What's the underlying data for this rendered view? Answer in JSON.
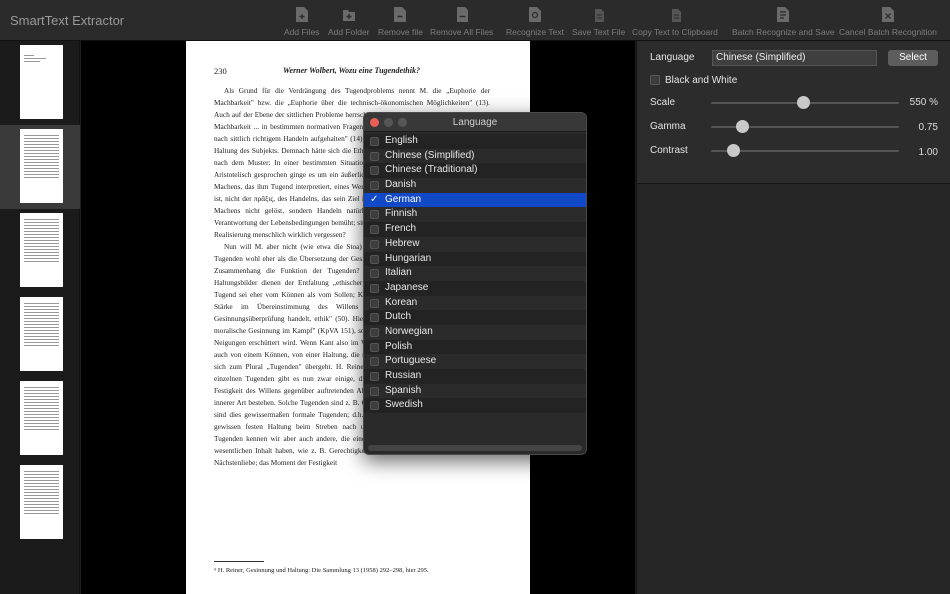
{
  "app": {
    "title": "SmartText Extractor"
  },
  "toolbar": [
    {
      "name": "add-files",
      "label": "Add Files"
    },
    {
      "name": "add-folder",
      "label": "Add Folder"
    },
    {
      "name": "remove-file",
      "label": "Remove file"
    },
    {
      "name": "remove-all-files",
      "label": "Remove All Files"
    },
    {
      "name": "recognize-text",
      "label": "Recognize Text"
    },
    {
      "name": "save-text-file",
      "label": "Save Text File"
    },
    {
      "name": "copy-text",
      "label": "Copy Text to Clipboard"
    },
    {
      "name": "batch-recognize",
      "label": "Batch Recognize and Save"
    },
    {
      "name": "cancel-batch",
      "label": "Cancel Batch Recognition"
    }
  ],
  "settings": {
    "language_label": "Language",
    "language_value": "Chinese (Simplified)",
    "select_label": "Select",
    "bw_label": "Black and White",
    "scale_label": "Scale",
    "scale_value": "550 %",
    "scale_pos": 0.49,
    "gamma_label": "Gamma",
    "gamma_value": "0.75",
    "gamma_pos": 0.17,
    "contrast_label": "Contrast",
    "contrast_value": "1.00",
    "contrast_pos": 0.12
  },
  "dialog": {
    "title": "Language",
    "items": [
      "English",
      "Chinese (Simplified)",
      "Chinese (Traditional)",
      "Danish",
      "German",
      "Finnish",
      "French",
      "Hebrew",
      "Hungarian",
      "Italian",
      "Japanese",
      "Korean",
      "Dutch",
      "Norwegian",
      "Polish",
      "Portuguese",
      "Russian",
      "Spanish",
      "Swedish"
    ],
    "selected": "German"
  },
  "document": {
    "page_number": "230",
    "running_head": "Werner Wolbert, Wozu eine Tugendethik?",
    "paragraphs": [
      "Als Grund für die Verdrängung des Tugendproblems nennt M. die „Euphorie der Machbarkeit\" bzw. die „Euphorie über die technisch-ökonomischen Möglichkeiten\" (13). Auch auf der Ebene der sittlichen Probleme herrsche ein Dominanz der normtechnologischen Machbarkeit ... in bestimmten normativen Fragen habe sich dabei „vor allem bei der Frage nach sittlich richtigem Handeln aufgehalten\" (14). Bei der Tugend geht es hingegen um die Haltung des Subjekts. Demnach hätte sich die Ethik weitgehend auf das Handeln beschränkt nach dem Muster: In einer bestimmten Situation gilt die Norm der Art H auszuführen. Aristotelisch gesprochen ginge es um ein äußerliches Handeln im Stil der ποίησις, also des Machens, das ihm Tugend interpretiert, eines Werks (ἔργον), das außerhalb des Handelnden ist, nicht der πρᾶξις, des Handelns, das sein Ziel in sich selbst hat. Insofern der Bereich des Machens nicht gelöst, sondern Handeln natürlich auch das Element der moralischen Verantwortung der Lebensbedingungen bemüht; sittliches Handeln, es trägt seinen Sinn in der Realisierung menschlich wirklich vergessen?",
      "Nun will M. aber nicht (wie etwa die Stoa) die Tugend herausstreichen. Er sieht die Tugenden wohl eher als die Übersetzung der Gesinnung in die entsprechenden Handlungen. Zusammenhang die Funktion der Tugenden? Hier ist M. zu geben: Tugenden als Haltungsbilder dienen der Entfaltung „ethischer Antriebskräfte\" (15), eine sittliche (16). Tugend sei eher vom Können als vom Sollen; Kant dagegen die Tugend bestimme als die Stärke im Übereinstimmung des Willens mit jeder Pflicht, um eine reine Gesinnungsüberprüfung handelt, ethik\" (50). Hier ist aber zu bedenken: Kant spricht von moralische Gesinnung im Kampf\" (KpVA 151), sondern auch um eine starke Gesinnung, die Neigungen erschüttert wird. Wenn Kant also im Widerstandskraft für diese fordert, redet er auch von einem Können, von einer Haltung, die nisse durchsetzt. Eine Schwierigkeit ergibt sich zum Plural „Tugenden\" übergeht. H. Reiner hat dies so beschrieben: „Unter diesen einzelnen Tugenden gibt es nun zwar einige, die in der Hauptsache tatsächlich in einer Festigkeit des Willens gegenüber auftretenden Ablenkungen und Hindernissen äußerer und innerer Art bestehen. Solche Tugenden sind z. B. Geduld, Ausdauer, Fleiß und Tapferkeit. Es sind dies gewissermaßen formale Tugenden; d.h. eben solche, die wesentlich nur in einer gewissen festen Haltung beim Streben nach unseren Zielen bestehen. Neben solchen Tugenden kennen wir aber auch andere, die eine Richtung auf bestimmte Ziele zu ihrem wesentlichen Inhalt haben, wie z. B. Gerechtigkeit, Rücksichtnahme, Hilfsbereitschaft und Nächstenliebe; das Moment der Festigkeit"
    ],
    "footnote": "⁵ H. Reiner, Gesinnung und Haltung: Die Sammlung 13 (1958) 292–298, hier 295."
  }
}
